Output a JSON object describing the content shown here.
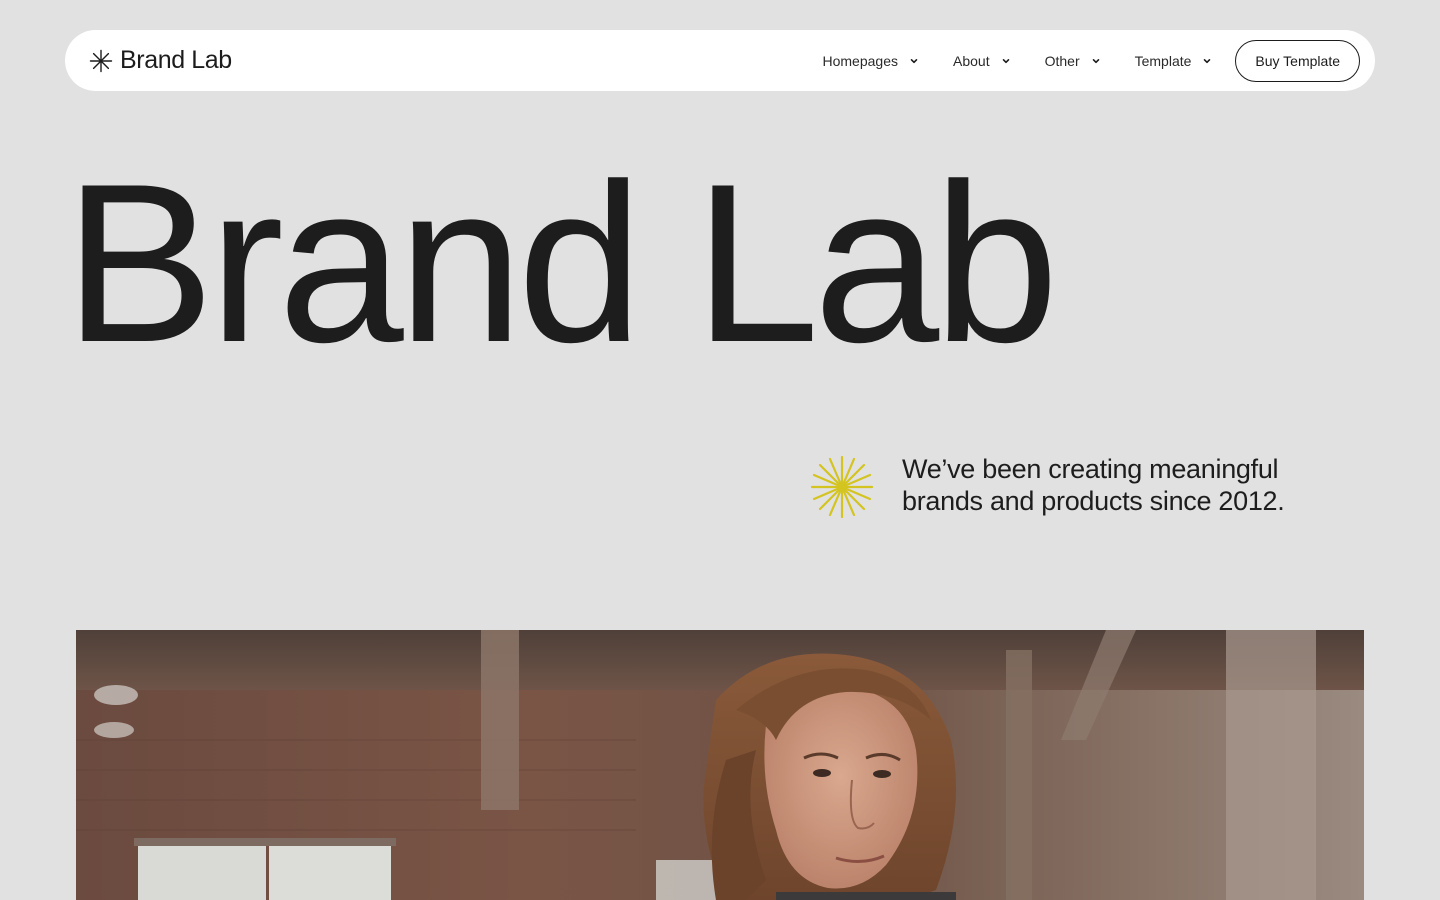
{
  "nav": {
    "brand_name": "Brand Lab",
    "brand_icon": "asterisk-icon",
    "items": [
      {
        "label": "Homepages",
        "icon": "chevron-down-icon"
      },
      {
        "label": "About",
        "icon": "chevron-down-icon"
      },
      {
        "label": "Other",
        "icon": "chevron-down-icon"
      },
      {
        "label": "Template",
        "icon": "chevron-down-icon"
      }
    ],
    "cta_label": "Buy Template"
  },
  "hero": {
    "title": "Brand Lab",
    "tagline": "We’ve been creating meaningful brands and products since 2012.",
    "accent_icon": "sparkle-icon",
    "accent_color": "#d4c41f"
  },
  "colors": {
    "background": "#e1e1e1",
    "text": "#1c1c1c",
    "nav_bg": "#ffffff"
  },
  "media": {
    "hero_image_icon": "photo-person-icon"
  }
}
